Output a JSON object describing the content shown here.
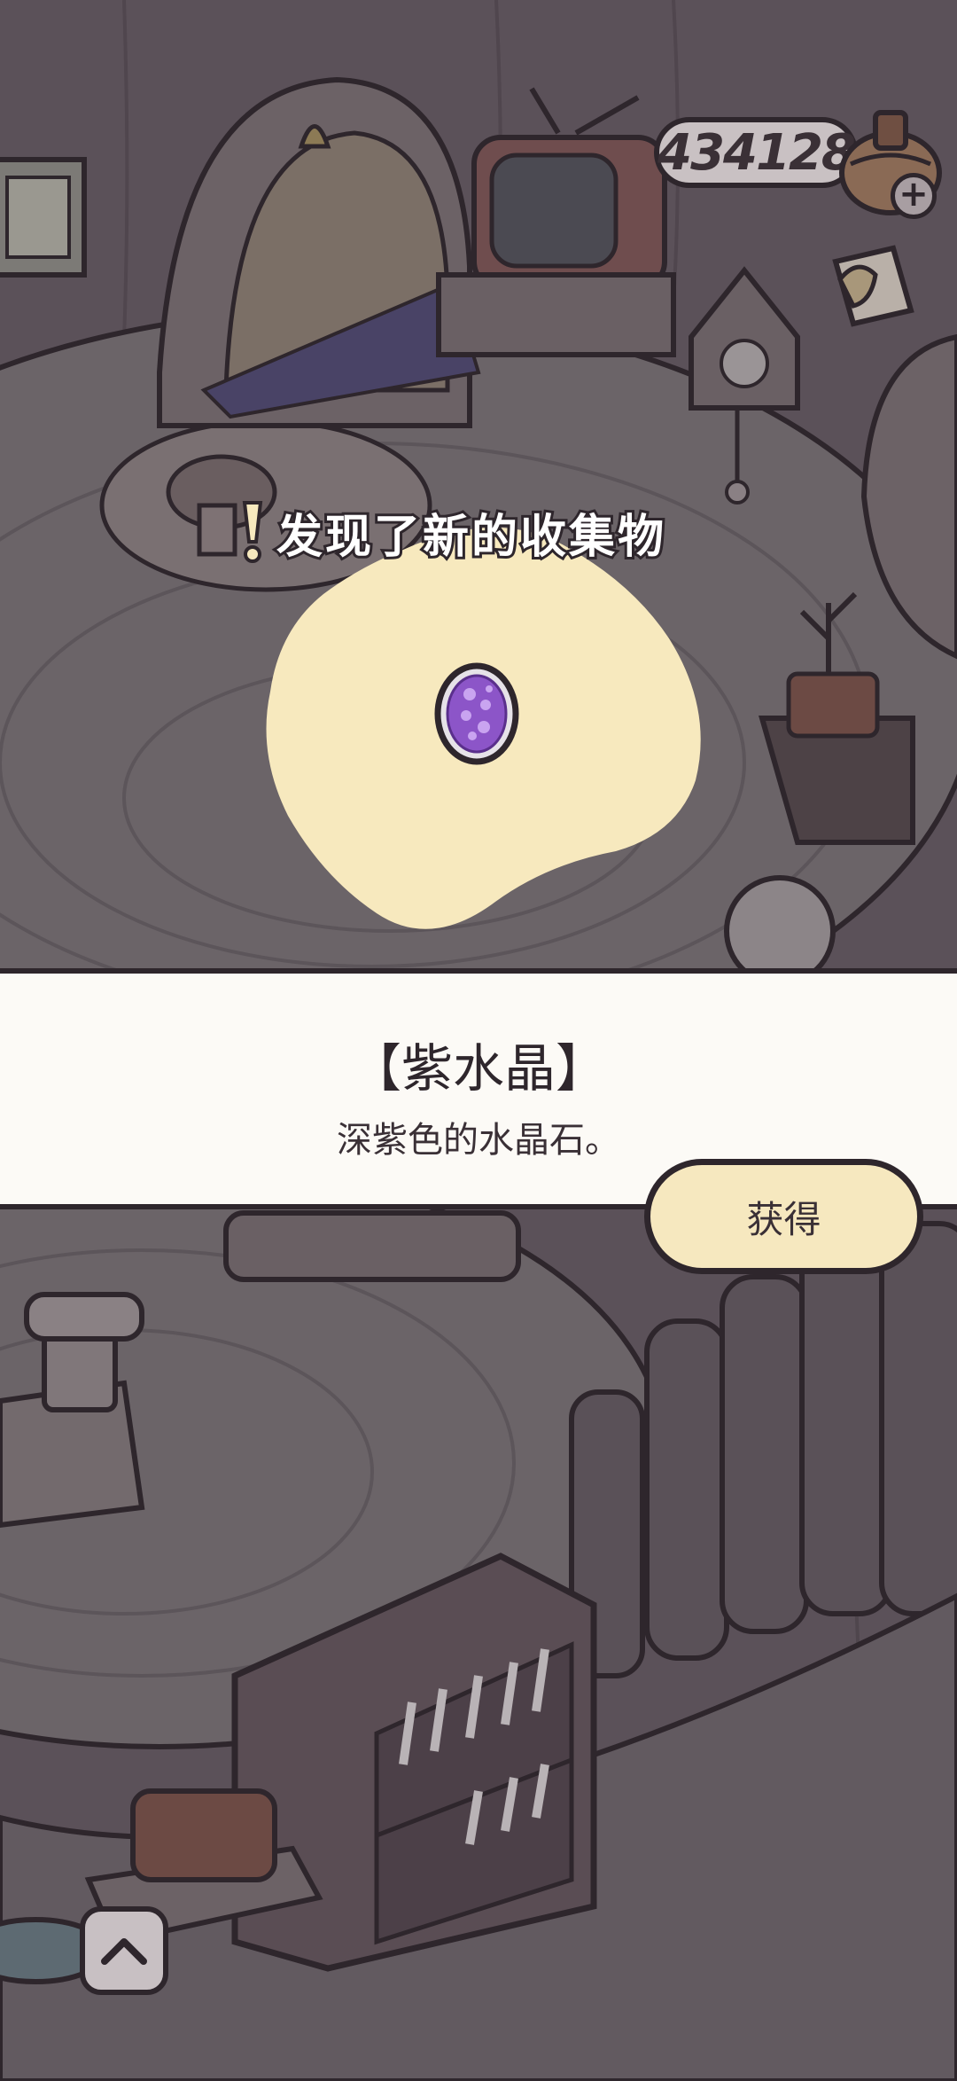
{
  "hud": {
    "coin_count": "434128",
    "add_coins_symbol": "+"
  },
  "discovery": {
    "title": "发现了新的收集物"
  },
  "item": {
    "name": "【紫水晶】",
    "description": "深紫色的水晶石。",
    "icon": "amethyst-icon"
  },
  "actions": {
    "obtain_label": "获得",
    "expand_icon": "chevron-up-icon"
  },
  "colors": {
    "highlight_blob": "#f7e9be",
    "panel_bg": "#fcfaf6",
    "button_bg": "#f6e8bf",
    "outline": "#2e262c",
    "crystal": "#8c55c8"
  }
}
